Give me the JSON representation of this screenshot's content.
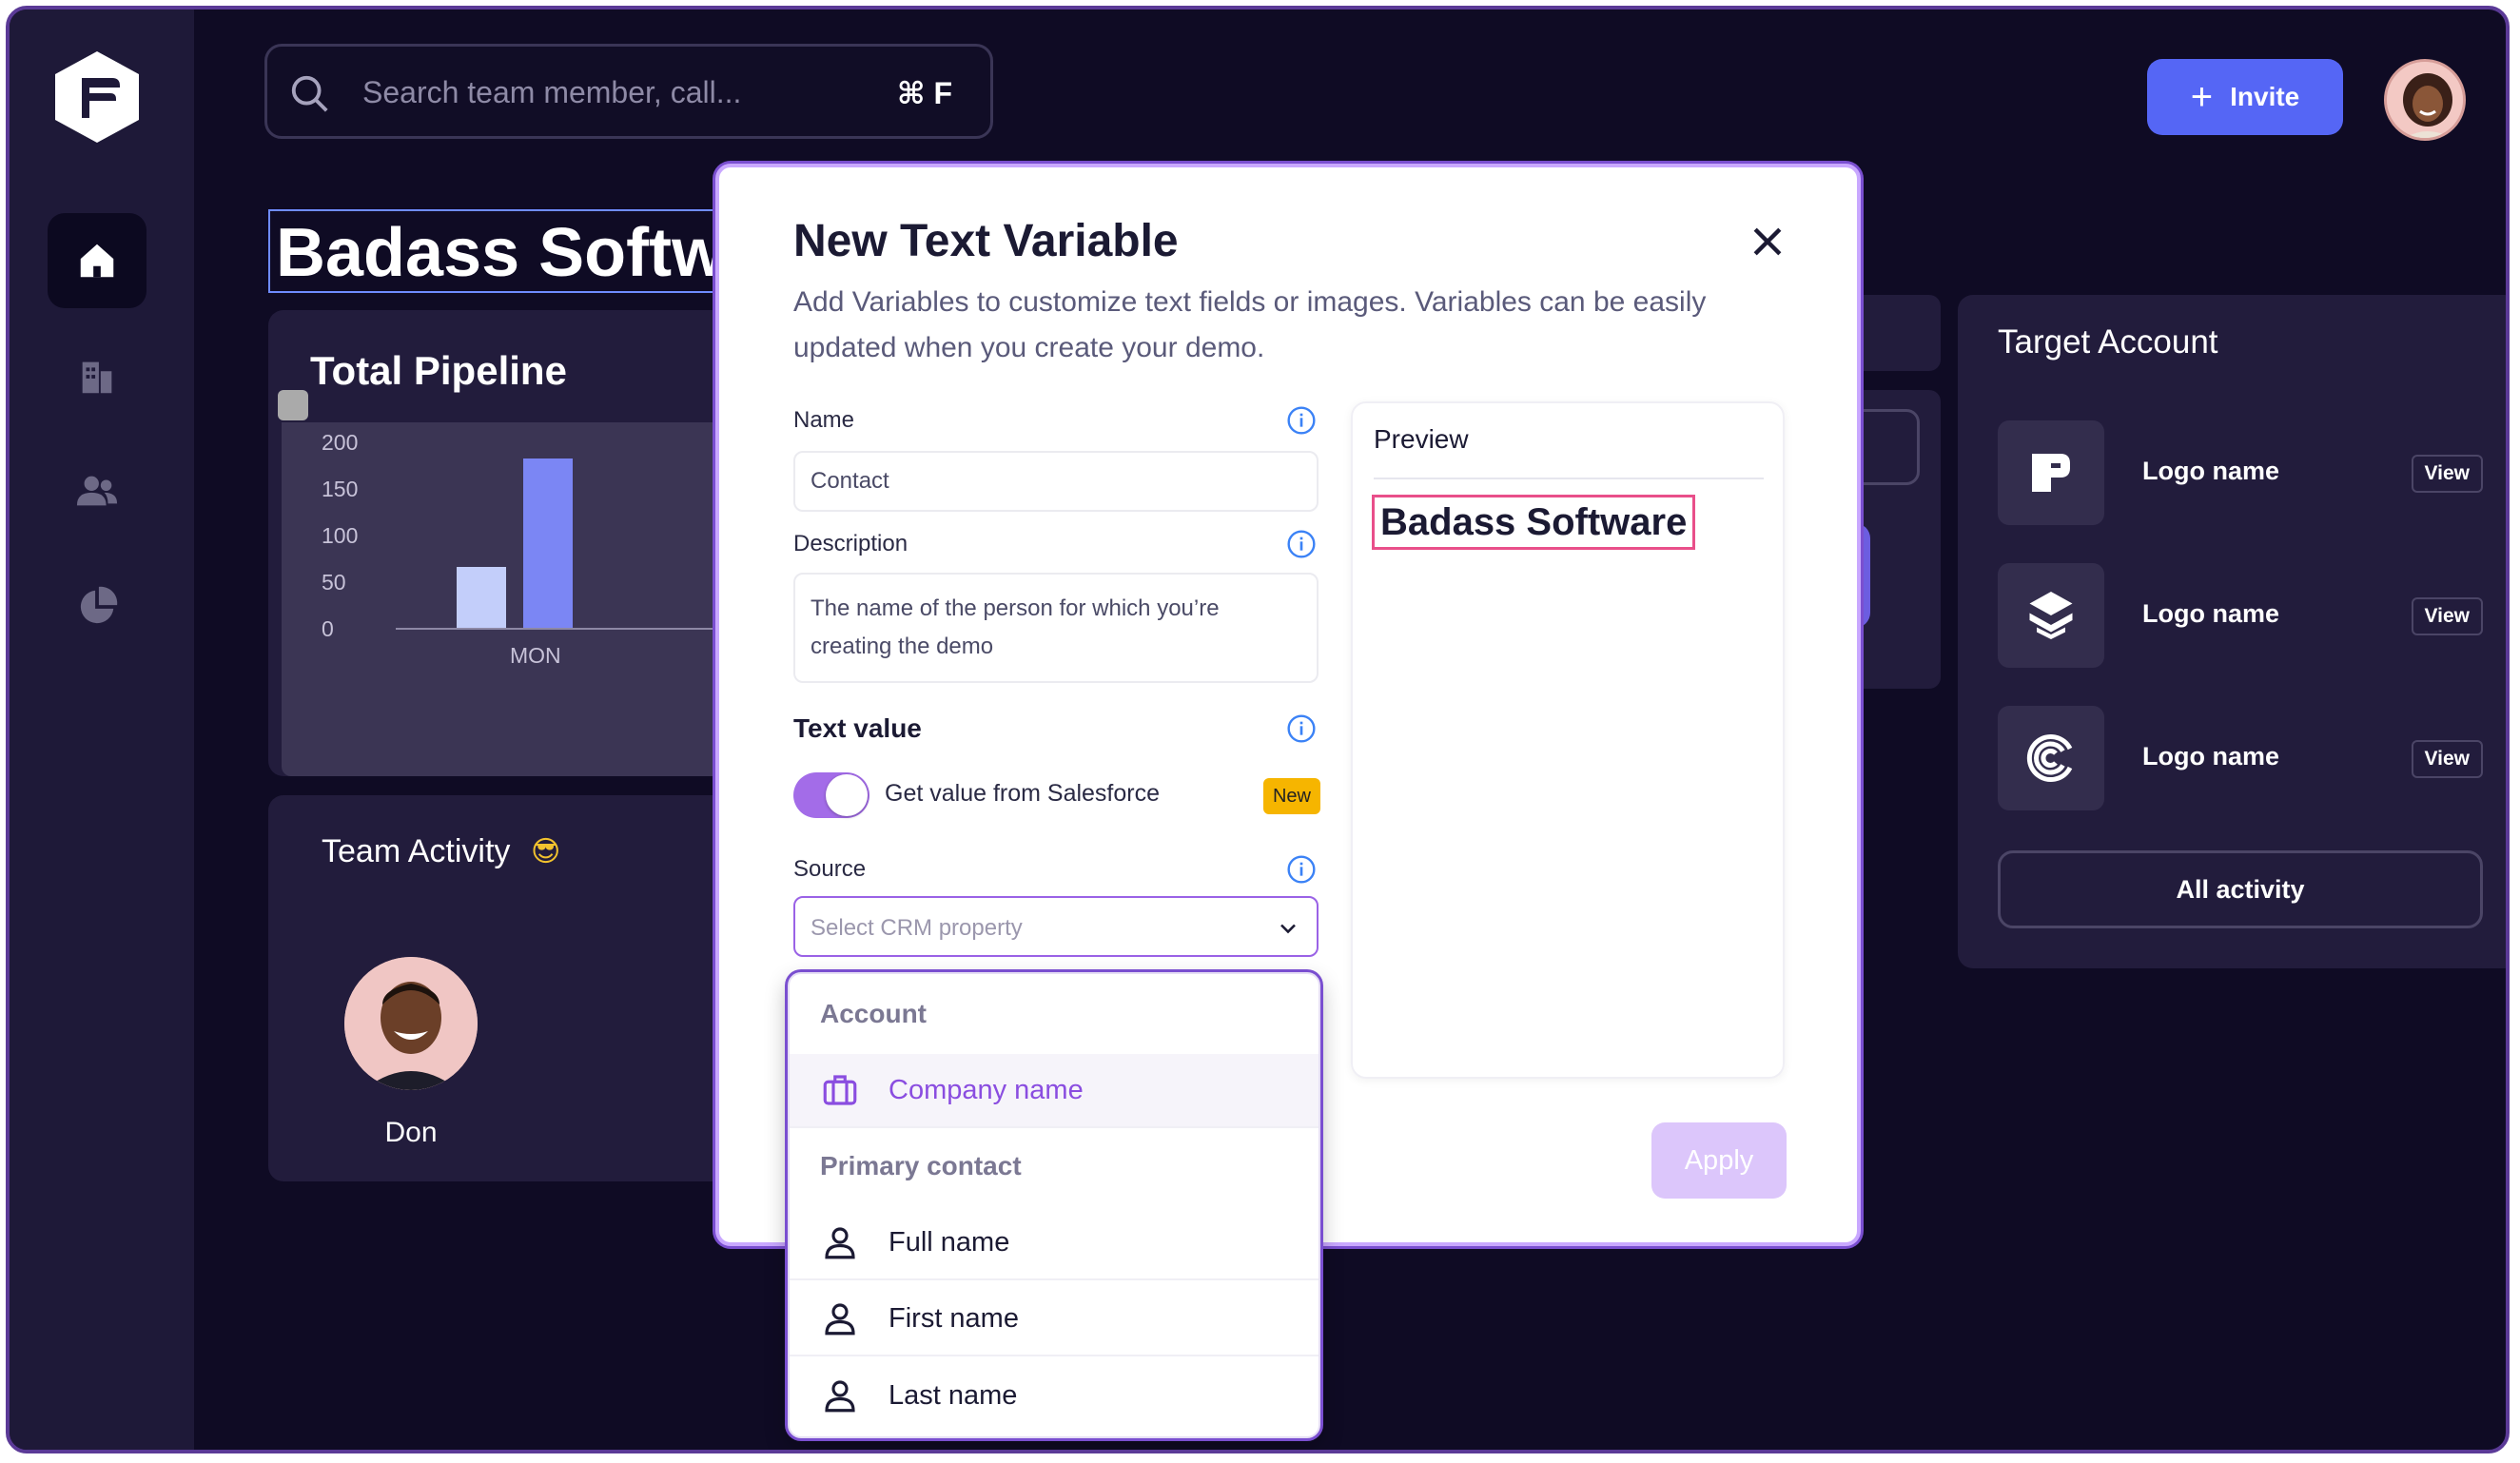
{
  "search": {
    "placeholder": "Search team member, call...",
    "shortcut": "⌘ F"
  },
  "header": {
    "invite_label": "Invite"
  },
  "page": {
    "title": "Badass Software"
  },
  "pipeline": {
    "title": "Total Pipeline",
    "chart_data": {
      "type": "bar",
      "categories": [
        "MON"
      ],
      "series": [
        {
          "values": [
            65
          ]
        },
        {
          "values": [
            182
          ]
        }
      ],
      "y_ticks": [
        "200",
        "150",
        "100",
        "50",
        "0"
      ],
      "ylim": [
        0,
        200
      ],
      "colors": [
        "#c3cefa",
        "#7b86f4"
      ]
    }
  },
  "team": {
    "title": "Team Activity",
    "emoji": "😎",
    "member": "Don"
  },
  "target": {
    "title": "Target Account",
    "rows": [
      {
        "name": "Logo name",
        "view": "View",
        "icon": "p-logo-icon"
      },
      {
        "name": "Logo name",
        "view": "View",
        "icon": "layers-logo-icon"
      },
      {
        "name": "Logo name",
        "view": "View",
        "icon": "spiral-logo-icon"
      }
    ],
    "all_activity": "All activity"
  },
  "modal": {
    "title": "New Text Variable",
    "subtitle": "Add Variables to customize text fields or images. Variables can be easily updated when you create your demo.",
    "name_label": "Name",
    "name_value": "Contact",
    "desc_label": "Description",
    "desc_value": "The name of the person for which you’re creating the demo",
    "text_value_label": "Text value",
    "toggle_label": "Get value from Salesforce",
    "toggle_on": true,
    "new_badge": "New",
    "source_label": "Source",
    "source_placeholder": "Select CRM property",
    "preview_title": "Preview",
    "preview_text": "Badass Software",
    "apply_label": "Apply"
  },
  "dropdown": {
    "group_account": "Account",
    "company_name": "Company name",
    "group_primary": "Primary contact",
    "full_name": "Full name",
    "first_name": "First name",
    "last_name": "Last name"
  },
  "colors": {
    "accent": "#5566f5",
    "purple": "#9a62e6",
    "highlight": "#e94f8a",
    "badge": "#f6b500"
  }
}
